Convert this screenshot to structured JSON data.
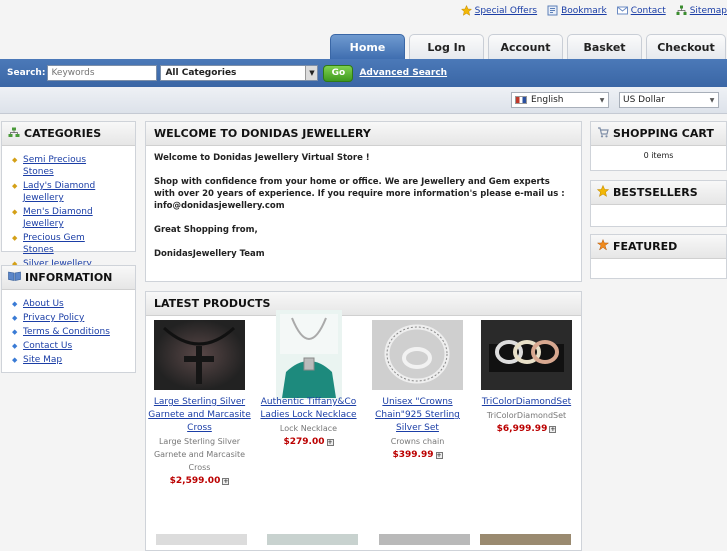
{
  "top_links": [
    {
      "label": "Special Offers",
      "icon": "star-icon"
    },
    {
      "label": "Bookmark",
      "icon": "bookmark-icon"
    },
    {
      "label": "Contact",
      "icon": "mail-icon"
    },
    {
      "label": "Sitemap",
      "icon": "sitemap-icon"
    }
  ],
  "tabs": [
    {
      "label": "Home",
      "active": true
    },
    {
      "label": "Log In"
    },
    {
      "label": "Account"
    },
    {
      "label": "Basket"
    },
    {
      "label": "Checkout"
    }
  ],
  "search": {
    "label": "Search:",
    "placeholder": "Keywords",
    "category": "All Categories",
    "go": "Go",
    "advanced": "Advanced Search"
  },
  "language": "English",
  "currency": "US Dollar",
  "categories": {
    "title": "CATEGORIES",
    "items": [
      "Semi Precious Stones",
      "Lady's Diamond Jewellery",
      "Men's Diamond Jewellery",
      "Precious Gem Stones",
      "Silver Jewellery"
    ]
  },
  "information": {
    "title": "INFORMATION",
    "items": [
      "About Us",
      "Privacy Policy",
      "Terms & Conditions",
      "Contact Us",
      "Site Map"
    ]
  },
  "welcome": {
    "title": "WELCOME TO DONIDAS JEWELLERY",
    "p1": "Welcome to Donidas Jewellery Virtual  Store !",
    "p2": "Shop with confidence from your home or office. We are Jewellery and Gem experts with over 20 years of experience. If you require more information's please e-mail us : info@donidasjewellery.com",
    "p3": "Great Shopping from,",
    "p4": "DonidasJewellery Team"
  },
  "latest": {
    "title": "LATEST PRODUCTS",
    "products": [
      {
        "name": "Large Sterling Silver Garnete and Marcasite Cross",
        "desc": "Large Sterling Silver Garnete and Marcasite Cross",
        "price": "$2,599.00"
      },
      {
        "name": "Authentic Tiffany&Co Ladies Lock Necklace",
        "desc": "Lock Necklace",
        "price": "$279.00"
      },
      {
        "name": "Unisex \"Crowns Chain\"925 Sterling Silver Set",
        "desc": "Crowns chain",
        "price": "$399.99"
      },
      {
        "name": "TriColorDiamondSet",
        "desc": "TriColorDiamondSet",
        "price": "$6,999.99"
      }
    ]
  },
  "cart": {
    "title": "SHOPPING CART",
    "items": "0 items"
  },
  "bestsellers": {
    "title": "BESTSELLERS"
  },
  "featured": {
    "title": "FEATURED"
  }
}
